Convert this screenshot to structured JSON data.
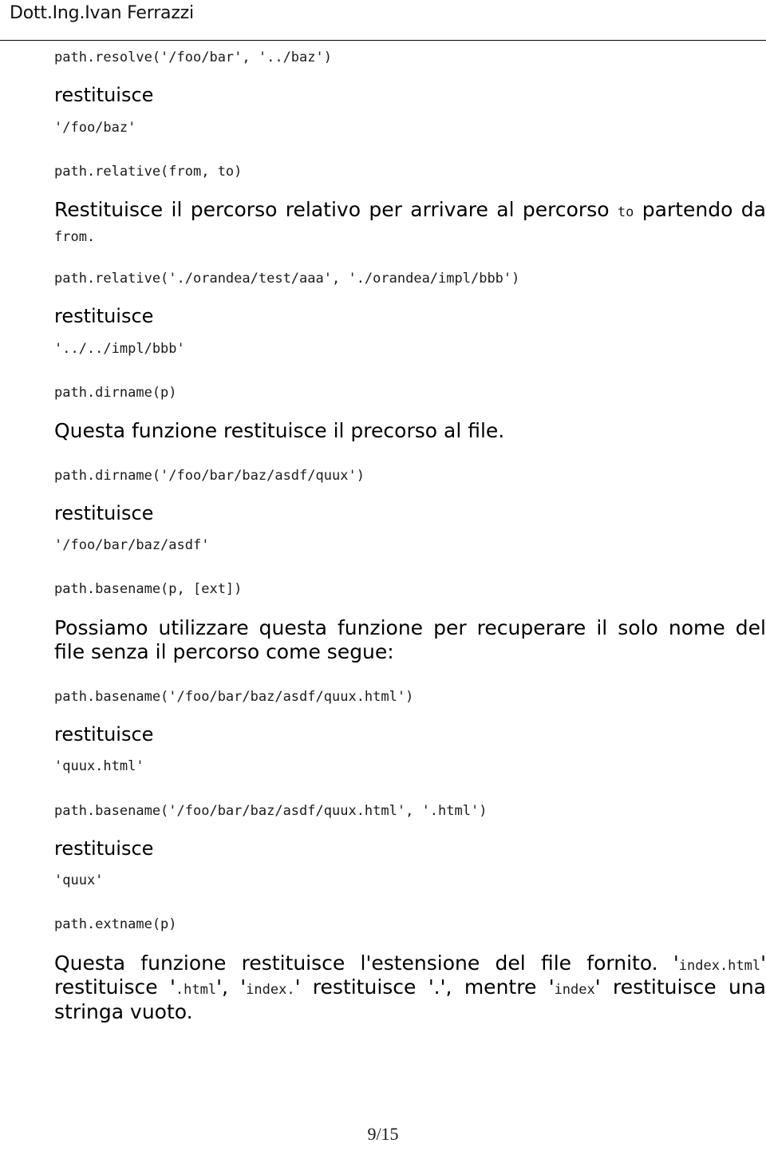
{
  "header": {
    "title": "Dott.Ing.Ivan Ferrazzi"
  },
  "footer": {
    "page_number": "9/15"
  },
  "labels": {
    "returns": "restituisce"
  },
  "blocks": {
    "resolve_example": {
      "signature": "path.resolve('/foo/bar', '../baz')",
      "result": "'/foo/baz'"
    },
    "relative": {
      "signature": "path.relative(from, to)",
      "desc_part1": "Restituisce il percorso relativo per arrivare al percorso ",
      "desc_code1": "to",
      "desc_part2": " partendo da ",
      "desc_code2": "from",
      "desc_part3": ".",
      "example_signature": "path.relative('./orandea/test/aaa', './orandea/impl/bbb')",
      "example_result": "'../../impl/bbb'"
    },
    "dirname": {
      "signature": "path.dirname(p)",
      "description": "Questa funzione restituisce il precorso al file.",
      "example_signature": "path.dirname('/foo/bar/baz/asdf/quux')",
      "example_result": "'/foo/bar/baz/asdf'"
    },
    "basename": {
      "signature": "path.basename(p, [ext])",
      "description": "Possiamo utilizzare questa funzione per recuperare il solo nome del file senza il percorso come segue:",
      "example1_signature": "path.basename('/foo/bar/baz/asdf/quux.html')",
      "example1_result": "'quux.html'",
      "example2_signature": "path.basename('/foo/bar/baz/asdf/quux.html', '.html')",
      "example2_result": "'quux'"
    },
    "extname": {
      "signature": "path.extname(p)",
      "desc_t1": "Questa funzione restituisce l'estensione del file fornito. ",
      "desc_q1_open": "'",
      "desc_c1": "index.html",
      "desc_q1_close": "'",
      "desc_t2": " restituisce ",
      "desc_q2_open": "'",
      "desc_c2": ".html",
      "desc_q2_close": "'",
      "desc_t3": ", ",
      "desc_q3_open": "'",
      "desc_c3": "index.",
      "desc_q3_close": "'",
      "desc_t4": " restituisce ",
      "desc_q4": "'.'",
      "desc_t5": ", mentre ",
      "desc_q5_open": "'",
      "desc_c5": "index",
      "desc_q5_close": "'",
      "desc_t6": " restituisce una stringa vuoto."
    }
  }
}
